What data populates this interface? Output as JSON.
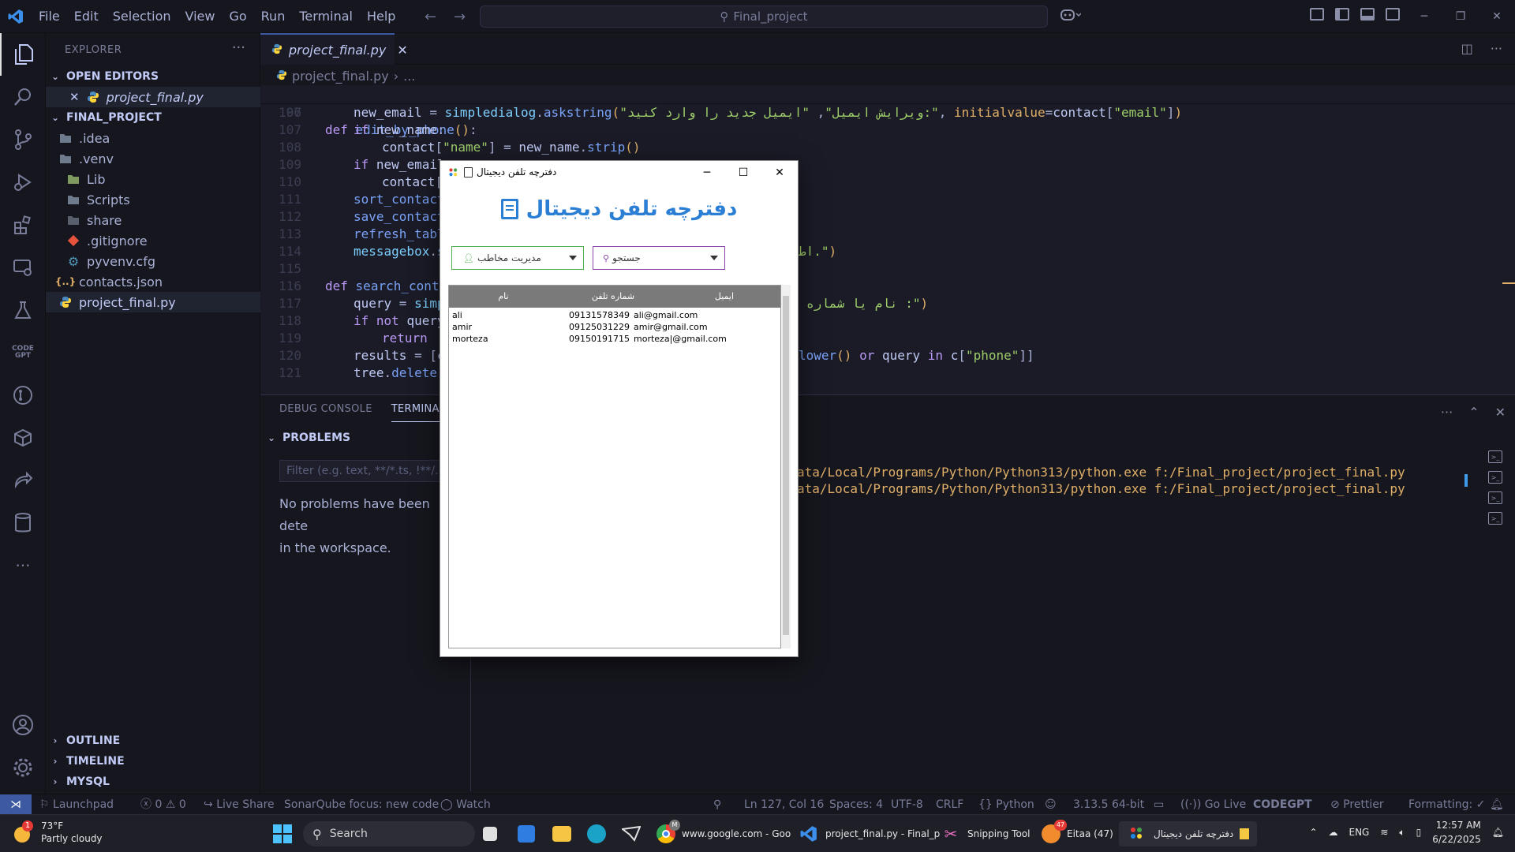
{
  "titlebar": {
    "menu": [
      "File",
      "Edit",
      "Selection",
      "View",
      "Go",
      "Run",
      "Terminal",
      "Help"
    ],
    "search_text": "Final_project"
  },
  "sidebar": {
    "title": "EXPLORER",
    "open_editors_label": "OPEN EDITORS",
    "open_editor_file": "project_final.py",
    "project_label": "FINAL_PROJECT",
    "files": [
      {
        "name": ".idea",
        "type": "folder"
      },
      {
        "name": ".venv",
        "type": "folder"
      },
      {
        "name": "Lib",
        "type": "folder"
      },
      {
        "name": "Scripts",
        "type": "folder"
      },
      {
        "name": "share",
        "type": "folder"
      },
      {
        "name": ".gitignore",
        "type": "git"
      },
      {
        "name": "pyvenv.cfg",
        "type": "config"
      },
      {
        "name": "contacts.json",
        "type": "json"
      },
      {
        "name": "project_final.py",
        "type": "python"
      }
    ],
    "outline_label": "OUTLINE",
    "timeline_label": "TIMELINE",
    "mysql_label": "MYSQL"
  },
  "editor": {
    "tab_label": "project_final.py",
    "breadcrumb_file": "project_final.py",
    "breadcrumb_more": "...",
    "sticky_line_no": "97",
    "lines": [
      {
        "no": "106"
      },
      {
        "no": "107"
      },
      {
        "no": "108"
      },
      {
        "no": "109"
      },
      {
        "no": "110"
      },
      {
        "no": "111"
      },
      {
        "no": "112"
      },
      {
        "no": "113"
      },
      {
        "no": "114"
      },
      {
        "no": "115"
      },
      {
        "no": "116"
      },
      {
        "no": "117"
      },
      {
        "no": "118"
      },
      {
        "no": "119"
      },
      {
        "no": "120"
      },
      {
        "no": "121"
      }
    ]
  },
  "panel": {
    "tabs": [
      "DEBUG CONSOLE",
      "TERMINAL"
    ],
    "problems_label": "PROBLEMS",
    "filter_placeholder": "Filter (e.g. text, **/*.ts, !**/...",
    "no_problems_line1": "No problems have been dete",
    "no_problems_line2": "in the workspace.",
    "terminal_lines": [
      "ata/Local/Programs/Python/Python313/python.exe f:/Final_project/project_final.py",
      "ata/Local/Programs/Python/Python313/python.exe f:/Final_project/project_final.py"
    ]
  },
  "statusbar": {
    "launchpad": "Launchpad",
    "errors": "0",
    "warnings": "0",
    "live_share": "Live Share",
    "sonar": "SonarQube focus: new code",
    "watch": "Watch",
    "position": "Ln 127, Col 16",
    "spaces": "Spaces: 4",
    "encoding": "UTF-8",
    "eol": "CRLF",
    "language": "Python",
    "interpreter": "3.13.5 64-bit",
    "go_live": "Go Live",
    "codegpt": "CODEGPT",
    "prettier": "Prettier",
    "formatting": "Formatting: ✓"
  },
  "tk_window": {
    "title": "دفترچه تلفن دیجیتال",
    "heading": "دفترچه تلفن دیجیتال",
    "combo_manage": "مدیریت مخاطب",
    "combo_search": "جستجو",
    "columns": [
      "نام",
      "شماره تلفن",
      "ایمیل"
    ],
    "rows": [
      [
        "ali",
        "09131578349",
        "ali@gmail.com"
      ],
      [
        "amir",
        "09125031229",
        "amir@gmail.com"
      ],
      [
        "morteza",
        "09150191715",
        "morteza|@gmail.com"
      ]
    ]
  },
  "taskbar": {
    "weather_temp": "73°F",
    "weather_desc": "Partly cloudy",
    "weather_badge": "1",
    "search_label": "Search",
    "apps": [
      {
        "label": "www.google.com - Goo",
        "badge": "M"
      },
      {
        "label": "project_final.py - Final_p"
      },
      {
        "label": "Snipping Tool"
      },
      {
        "label": "Eitaa (47)",
        "badge": "47"
      },
      {
        "label": "دفترچه تلفن دیجیتال"
      }
    ],
    "lang": "ENG",
    "time": "12:57 AM",
    "date": "6/22/2025"
  },
  "colors": {
    "accent": "#3d59a1",
    "tk_heading": "#2a7fd4",
    "combo_green": "#4caf50",
    "combo_purple": "#8e44ad"
  }
}
